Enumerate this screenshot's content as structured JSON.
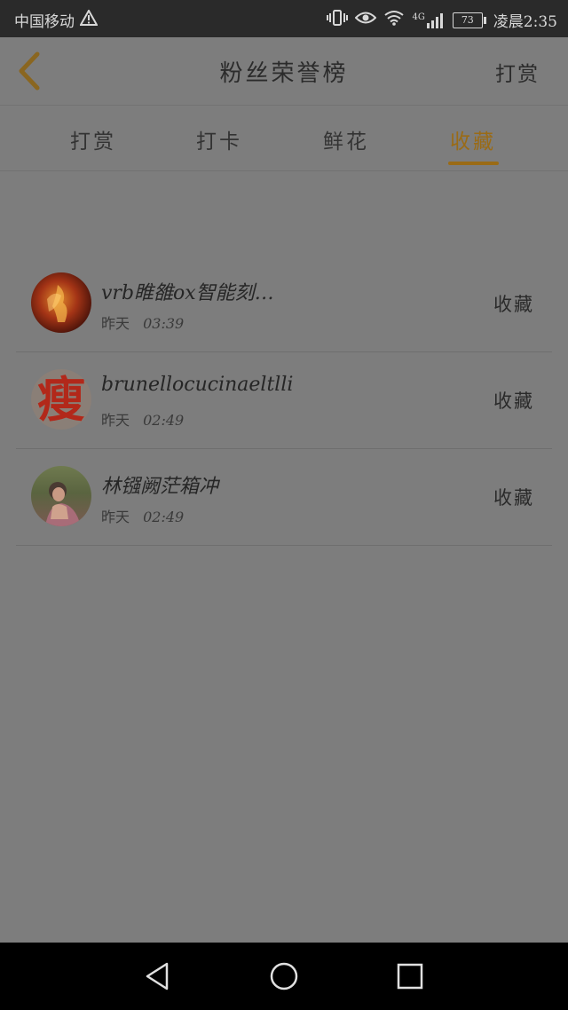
{
  "status_bar": {
    "carrier": "中国移动",
    "network": "4G",
    "battery": "73",
    "time": "凌晨2:35"
  },
  "header": {
    "title": "粉丝荣誉榜",
    "action_label": "打赏"
  },
  "tabs": [
    {
      "label": "打赏",
      "active": false
    },
    {
      "label": "打卡",
      "active": false
    },
    {
      "label": "鲜花",
      "active": false
    },
    {
      "label": "收藏",
      "active": true
    }
  ],
  "list": [
    {
      "name": "vrb睢雒ox智能刻…",
      "day": "昨天",
      "time": "03:39",
      "action": "收藏",
      "avatar": "fire-dancer-photo"
    },
    {
      "name": "brunellocucinaeltlli",
      "day": "昨天",
      "time": "02:49",
      "action": "收藏",
      "avatar": "red-character-logo",
      "avatar_text": "瘦"
    },
    {
      "name": "林镪阙茫箱冲",
      "day": "昨天",
      "time": "02:49",
      "action": "收藏",
      "avatar": "woman-portrait-photo"
    }
  ],
  "colors": {
    "accent": "#9a6b16",
    "overlay_bg": "#7d7d7d",
    "status_bg": "#2a2a2a"
  }
}
